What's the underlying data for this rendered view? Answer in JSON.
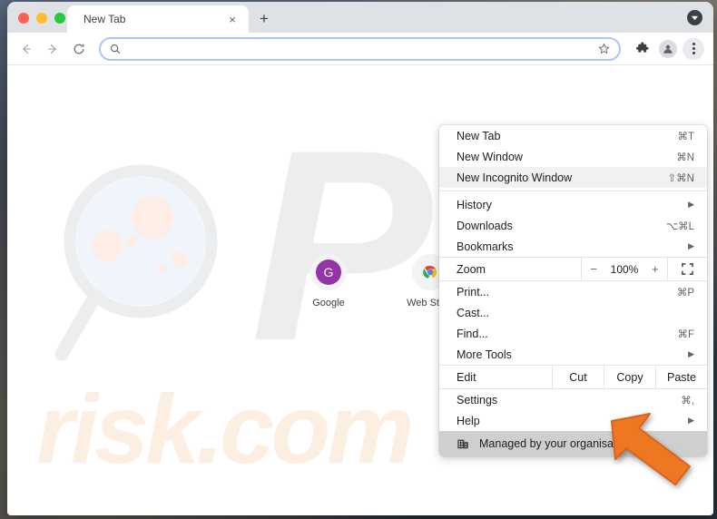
{
  "window": {
    "traffic_lights": [
      "close",
      "minimize",
      "maximize"
    ],
    "tab": {
      "title": "New Tab",
      "close_label": "×"
    },
    "new_tab_button": "+",
    "tab_search_icon": "tab-search-chevron"
  },
  "toolbar": {
    "back_icon": "arrow-left-icon",
    "forward_icon": "arrow-right-icon",
    "reload_icon": "reload-icon",
    "search_icon": "search-icon",
    "address_value": "",
    "address_placeholder": "",
    "star_icon": "bookmark-star-icon",
    "extensions_icon": "puzzle-piece-icon",
    "profile_icon": "profile-avatar-icon",
    "menu_icon": "three-dot-menu-icon"
  },
  "page": {
    "watermark_primary": "P",
    "watermark_secondary": "risk.com",
    "magnifier_icon": "magnifying-glass-graphic",
    "shortcuts": [
      {
        "label": "Google",
        "icon": "google-g-icon",
        "glyph": "G"
      },
      {
        "label": "Web Store",
        "icon": "chrome-web-store-icon"
      }
    ]
  },
  "menu": {
    "items": [
      {
        "label": "New Tab",
        "accel": "⌘T",
        "arrow": "",
        "highlight": false
      },
      {
        "label": "New Window",
        "accel": "⌘N",
        "arrow": "",
        "highlight": false
      },
      {
        "label": "New Incognito Window",
        "accel": "⇧⌘N",
        "arrow": "",
        "highlight": true
      }
    ],
    "items2": [
      {
        "label": "History",
        "accel": "",
        "arrow": "▶",
        "highlight": false
      },
      {
        "label": "Downloads",
        "accel": "⌥⌘L",
        "arrow": "",
        "highlight": false
      },
      {
        "label": "Bookmarks",
        "accel": "",
        "arrow": "▶",
        "highlight": false
      }
    ],
    "zoom": {
      "label": "Zoom",
      "minus": "−",
      "value": "100%",
      "plus": "+",
      "fullscreen_icon": "fullscreen-icon"
    },
    "items3": [
      {
        "label": "Print...",
        "accel": "⌘P",
        "arrow": "",
        "highlight": false
      },
      {
        "label": "Cast...",
        "accel": "",
        "arrow": "",
        "highlight": false
      },
      {
        "label": "Find...",
        "accel": "⌘F",
        "arrow": "",
        "highlight": false
      },
      {
        "label": "More Tools",
        "accel": "",
        "arrow": "▶",
        "highlight": false
      }
    ],
    "edit": {
      "label": "Edit",
      "cut": "Cut",
      "copy": "Copy",
      "paste": "Paste"
    },
    "items4": [
      {
        "label": "Settings",
        "accel": "⌘,",
        "arrow": "",
        "highlight": false
      },
      {
        "label": "Help",
        "accel": "",
        "arrow": "▶",
        "highlight": false
      }
    ],
    "managed": {
      "label": "Managed by your organisation",
      "icon": "organisation-building-icon"
    }
  },
  "annotation": {
    "arrow_icon": "orange-pointer-arrow",
    "color": "#ee7722"
  },
  "colors": {
    "tabstrip": "#dee1e6",
    "omnibox_border": "#a8c7fa",
    "google_tile": "#9334a8",
    "managed_bar": "#cfcfcf",
    "annotation_orange": "#ee7722",
    "watermark_gray": "#eceded",
    "watermark_peach": "#fdeee2"
  }
}
